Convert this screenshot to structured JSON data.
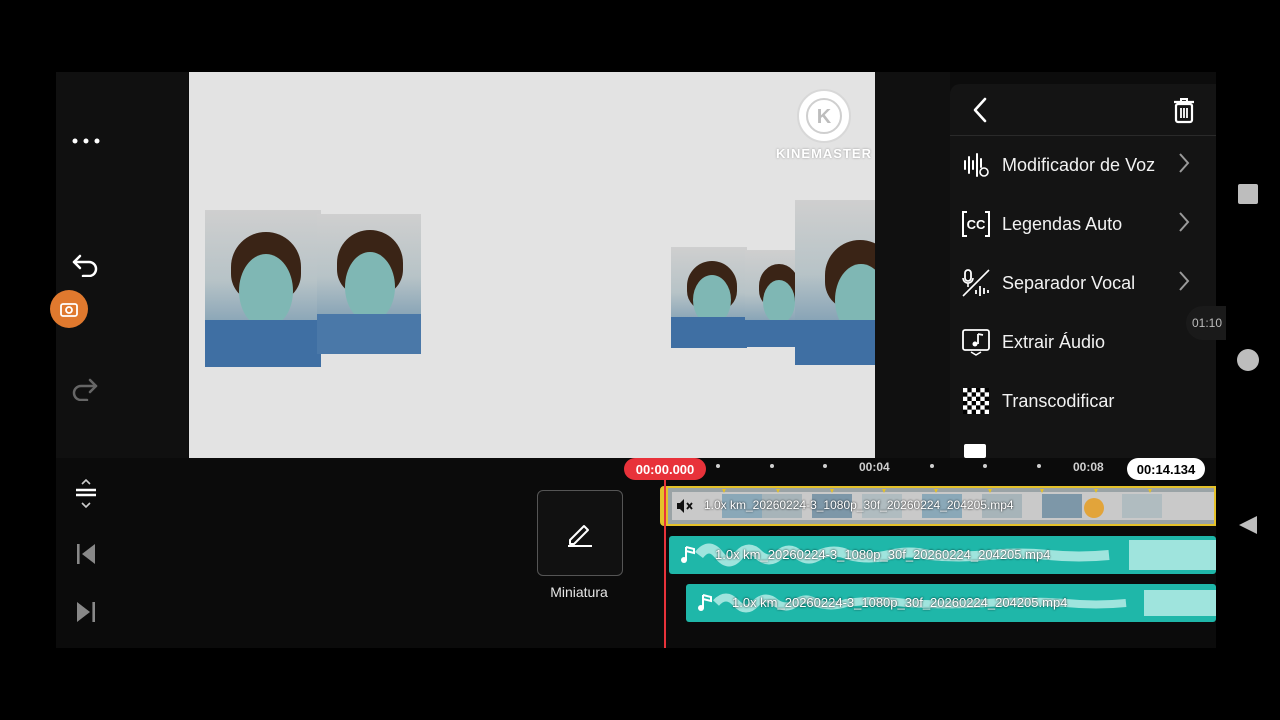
{
  "app": {
    "watermark": "KINEMASTER"
  },
  "left_toolbar": {
    "more_icon": "more-horizontal-icon",
    "undo_icon": "undo-icon",
    "capture_icon": "camera-capture-icon",
    "redo_icon": "redo-icon"
  },
  "panel": {
    "back_icon": "chevron-left-icon",
    "delete_icon": "trash-icon",
    "items": [
      {
        "label": "Modificador de Voz",
        "icon": "voice-modifier-icon",
        "has_submenu": true
      },
      {
        "label": "Legendas Auto",
        "icon": "closed-captions-icon",
        "has_submenu": true
      },
      {
        "label": "Separador Vocal",
        "icon": "vocal-separator-icon",
        "has_submenu": true
      },
      {
        "label": "Extrair Áudio",
        "icon": "extract-audio-icon",
        "has_submenu": false
      },
      {
        "label": "Transcodificar",
        "icon": "transcode-icon",
        "has_submenu": false
      }
    ],
    "side_time": "01:10"
  },
  "timeline": {
    "current_time": "00:00.000",
    "end_time": "00:14.134",
    "ruler_labels": [
      "00:04",
      "00:08"
    ],
    "thumbnail_button_label": "Miniatura",
    "video_clip_label": "1.0x km_20260224-3_1080p_30f_20260224_204205.mp4",
    "audio_tracks": [
      {
        "label": "1.0x km_20260224-3_1080p_30f_20260224_204205.mp4"
      },
      {
        "label": "1.0x km_20260224-3_1080p_30f_20260224_204205.mp4"
      }
    ],
    "colors": {
      "playhead": "#e8323a",
      "video_border": "#e4c12a",
      "audio_track": "#1fb7a9"
    }
  },
  "bottom_toolbar": {
    "expand_icon": "expand-timeline-icon",
    "skip_start_icon": "skip-to-start-icon",
    "skip_end_icon": "skip-to-end-icon"
  },
  "system_nav": {
    "recents_icon": "recents-square-icon",
    "home_icon": "home-circle-icon",
    "back_icon": "back-triangle-icon"
  }
}
